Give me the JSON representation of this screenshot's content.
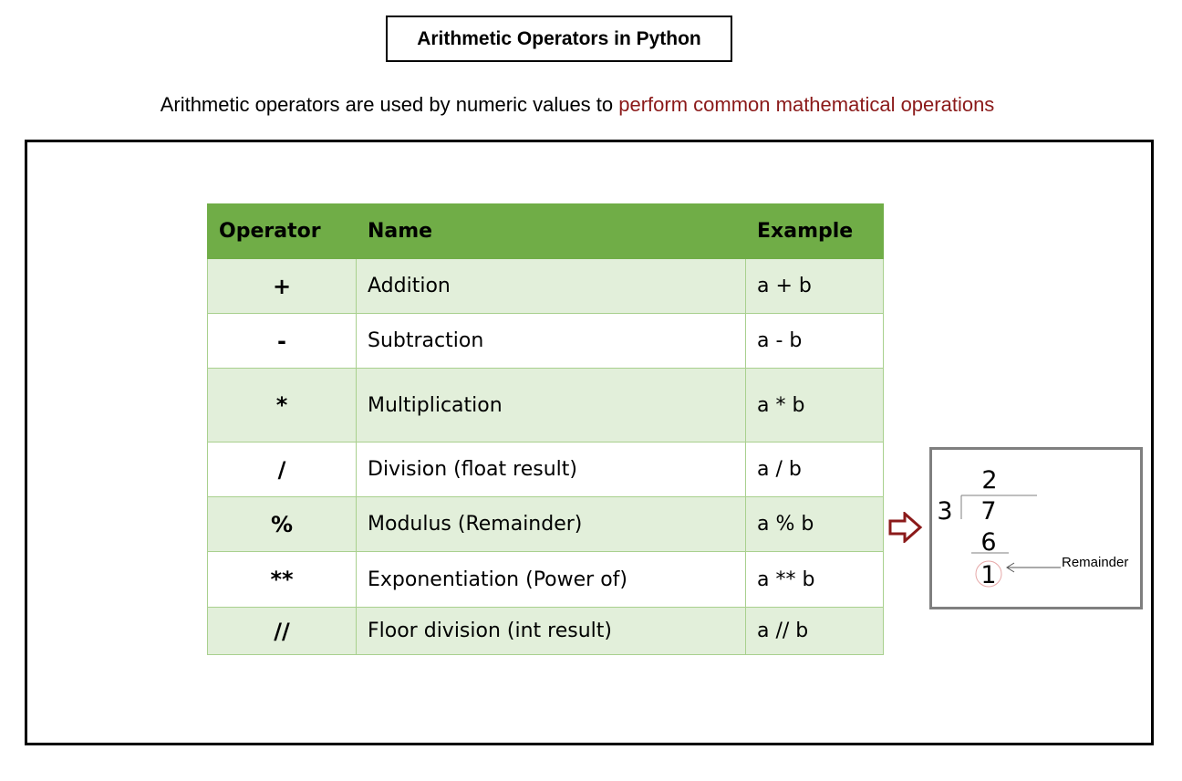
{
  "title": "Arithmetic Operators in Python",
  "subtitle": {
    "text": "Arithmetic operators are used by numeric values to ",
    "highlight": "perform common mathematical operations"
  },
  "table": {
    "headers": [
      "Operator",
      "Name",
      "Example"
    ],
    "rows": [
      {
        "operator": "+",
        "name": "Addition",
        "example": "a + b"
      },
      {
        "operator": "-",
        "name": "Subtraction",
        "example": "a - b"
      },
      {
        "operator": "*",
        "name": "Multiplication",
        "example": "a * b"
      },
      {
        "operator": "/",
        "name": "Division (float result)",
        "example": "a / b"
      },
      {
        "operator": "%",
        "name": "Modulus (Remainder)",
        "example": "a % b"
      },
      {
        "operator": "**",
        "name": "Exponentiation (Power of)",
        "example": "a ** b"
      },
      {
        "operator": "//",
        "name": "Floor division (int result)",
        "example": "a // b"
      }
    ]
  },
  "division_example": {
    "quotient": "2",
    "divisor": "3",
    "dividend": "7",
    "product": "6",
    "remainder": "1",
    "remainder_label": "Remainder"
  },
  "colors": {
    "header_green": "#70ad47",
    "row_light_green": "#e2efda",
    "highlight_red": "#8b1a1a",
    "arrow_red": "#8b1a1a"
  }
}
